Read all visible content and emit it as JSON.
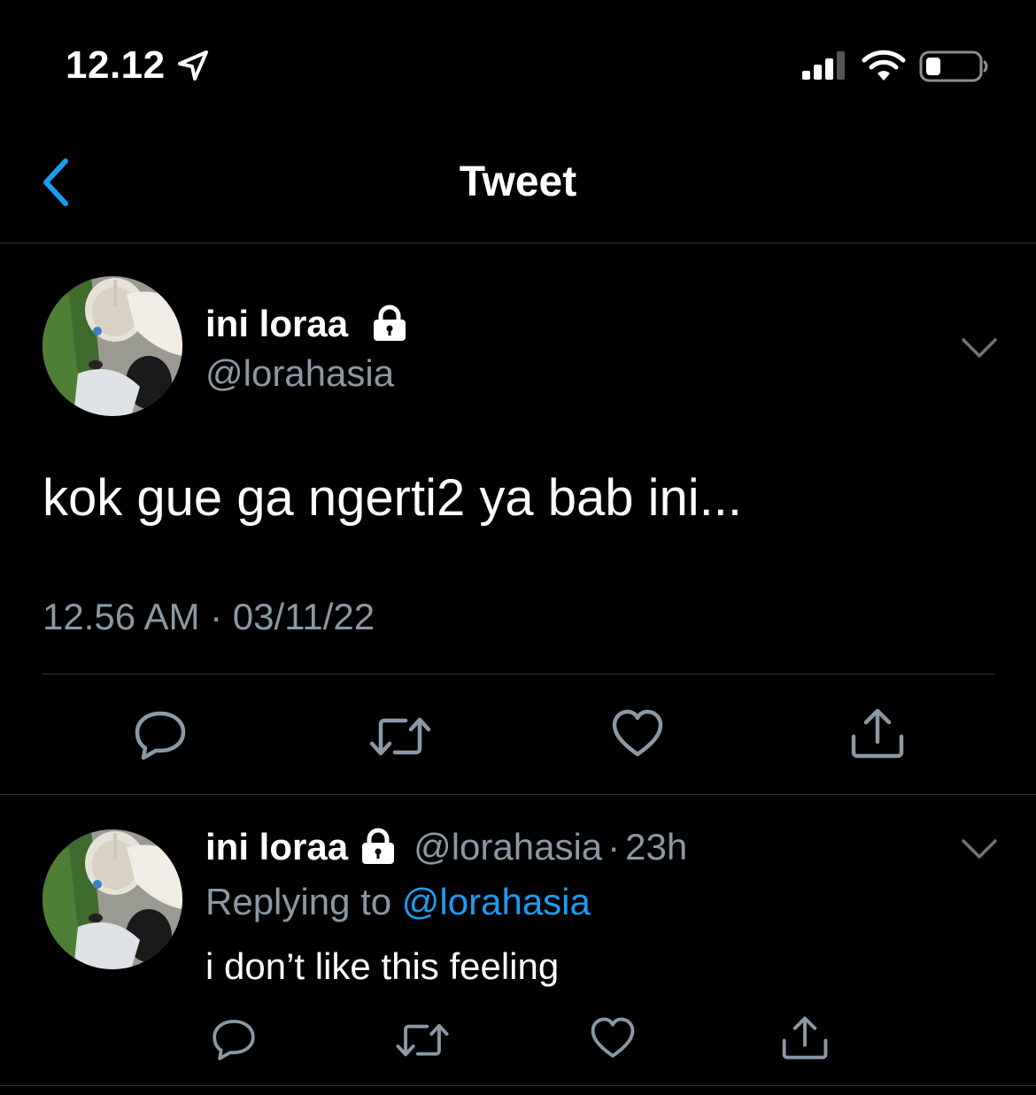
{
  "status_bar": {
    "time": "12.12"
  },
  "nav": {
    "title": "Tweet"
  },
  "tweet": {
    "display_name": "ini loraa",
    "handle": "@lorahasia",
    "text": "kok gue ga ngerti2 ya bab ini...",
    "timestamp": "12.56 AM · 03/11/22"
  },
  "reply": {
    "display_name": "ini loraa",
    "handle": "@lorahasia",
    "separator": "·",
    "time": "23h",
    "replying_label": "Replying to",
    "replying_to": "@lorahasia",
    "text": "i don’t like this feeling"
  },
  "icons": {
    "location": "location-arrow-icon",
    "signal": "cellular-signal-icon",
    "wifi": "wifi-icon",
    "battery": "battery-icon",
    "back": "chevron-left-icon",
    "lock": "lock-icon",
    "more": "chevron-down-icon",
    "reply": "comment-icon",
    "retweet": "retweet-icon",
    "like": "heart-icon",
    "share": "share-icon"
  },
  "colors": {
    "background": "#000000",
    "text": "#ffffff",
    "secondary": "#8b98a5",
    "accent": "#1d9bf0",
    "divider": "#2f3336"
  }
}
